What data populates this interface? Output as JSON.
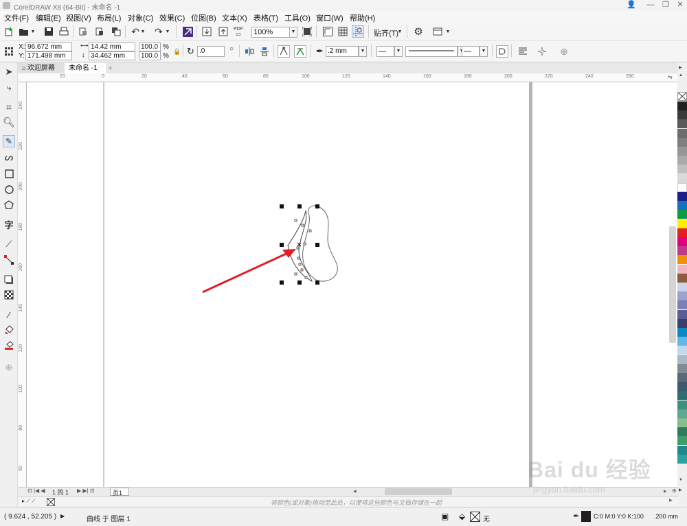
{
  "app": {
    "title": "CorelDRAW X8 (64-Bit) - 未命名 -1",
    "window_buttons": [
      "👤",
      "—",
      "❐",
      "✕"
    ]
  },
  "menu": [
    "文件(F)",
    "编辑(E)",
    "视图(V)",
    "布局(L)",
    "对象(C)",
    "效果(C)",
    "位图(B)",
    "文本(X)",
    "表格(T)",
    "工具(O)",
    "窗口(W)",
    "帮助(H)"
  ],
  "toolbar": {
    "zoom": "100%",
    "snap_label": "贴齐(T)",
    "pdf_label": "PDF"
  },
  "propbar": {
    "x_label": "X:",
    "y_label": "Y:",
    "x_value": "96.672 mm",
    "y_value": "171.498 mm",
    "w_value": "14.42 mm",
    "h_value": "34.462 mm",
    "sx_value": "100.0",
    "sy_value": "100.0",
    "pct": "%",
    "rotation": ".0",
    "outline_width": ".2 mm"
  },
  "tabs": {
    "welcome": "欢迎屏幕",
    "doc": "未命名 -1",
    "add": "+"
  },
  "ruler_top_ticks": [
    "20",
    "0",
    "20",
    "40",
    "60",
    "80",
    "100",
    "120",
    "140",
    "160",
    "180",
    "200",
    "220",
    "240",
    "260"
  ],
  "ruler_left_ticks": [
    "240",
    "220",
    "200",
    "180",
    "160",
    "140",
    "120",
    "100",
    "80",
    "60"
  ],
  "pagebar": {
    "page_count": "1 的 1",
    "page_tab": "页1"
  },
  "docpal_hint": "将颜色(或对象)拖动至此处，以便将这些颜色与文档存储在一起",
  "status": {
    "coords": "( 9.624 , 52.205 )",
    "object_info": "曲线 于 图层 1",
    "fill_none": "无",
    "color_values": "C:0 M:0 Y:0 K:100",
    "outline": ".200 mm"
  },
  "palette_colors": [
    "#231f20",
    "#3b3b3b",
    "#595959",
    "#6d6d6d",
    "#7f7f7f",
    "#969696",
    "#aaaaaa",
    "#c0c0c0",
    "#d9d9d9",
    "#ffffff",
    "#1d1f8a",
    "#0f74bc",
    "#0c9a48",
    "#ffee00",
    "#e31e24",
    "#e3007d",
    "#bf3a8a",
    "#f39200",
    "#f4b6be",
    "#8b5e3c",
    "#cfd3e9",
    "#9aa2d0",
    "#7b7fba",
    "#5a5c93",
    "#3b3e6d",
    "#0b89c5",
    "#62b6e6",
    "#bfd9ee",
    "#aab7c4",
    "#7f8b97",
    "#5c6a77",
    "#3e5a6e",
    "#2d6f6f",
    "#3f8f80",
    "#5da88f",
    "#86be8f",
    "#2e7b5c",
    "#3c9f6b",
    "#1e8a8a",
    "#2aa3a3"
  ],
  "watermark": {
    "brand": "Bai du 经验",
    "url": "jingyan.baidu.com"
  }
}
